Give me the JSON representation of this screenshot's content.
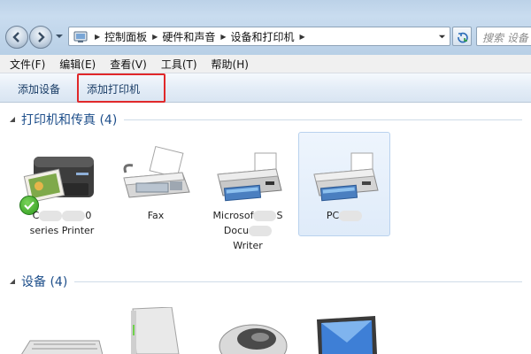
{
  "address": {
    "crumbs": [
      "控制面板",
      "硬件和声音",
      "设备和打印机"
    ]
  },
  "search": {
    "placeholder": "搜索 设备"
  },
  "menu": [
    "文件(F)",
    "编辑(E)",
    "查看(V)",
    "工具(T)",
    "帮助(H)"
  ],
  "toolbar": {
    "add_device": "添加设备",
    "add_printer": "添加打印机"
  },
  "groups": {
    "printers": {
      "title": "打印机和传真 (4)"
    },
    "devices": {
      "title": "设备 (4)"
    }
  },
  "printers": [
    {
      "line1_start": "C",
      "line1_end": "0",
      "line2": "series Printer",
      "default": true
    },
    {
      "line1": "Fax"
    },
    {
      "line1_start": "Microsof",
      "line1_end": "S",
      "line2_start": "Docu",
      "line2_end": "",
      "line3": "Writer"
    },
    {
      "line1_start": "PC",
      "line1_end": ""
    }
  ],
  "colors": {
    "highlight": "#e0282a",
    "group_title": "#1d4e8a"
  }
}
